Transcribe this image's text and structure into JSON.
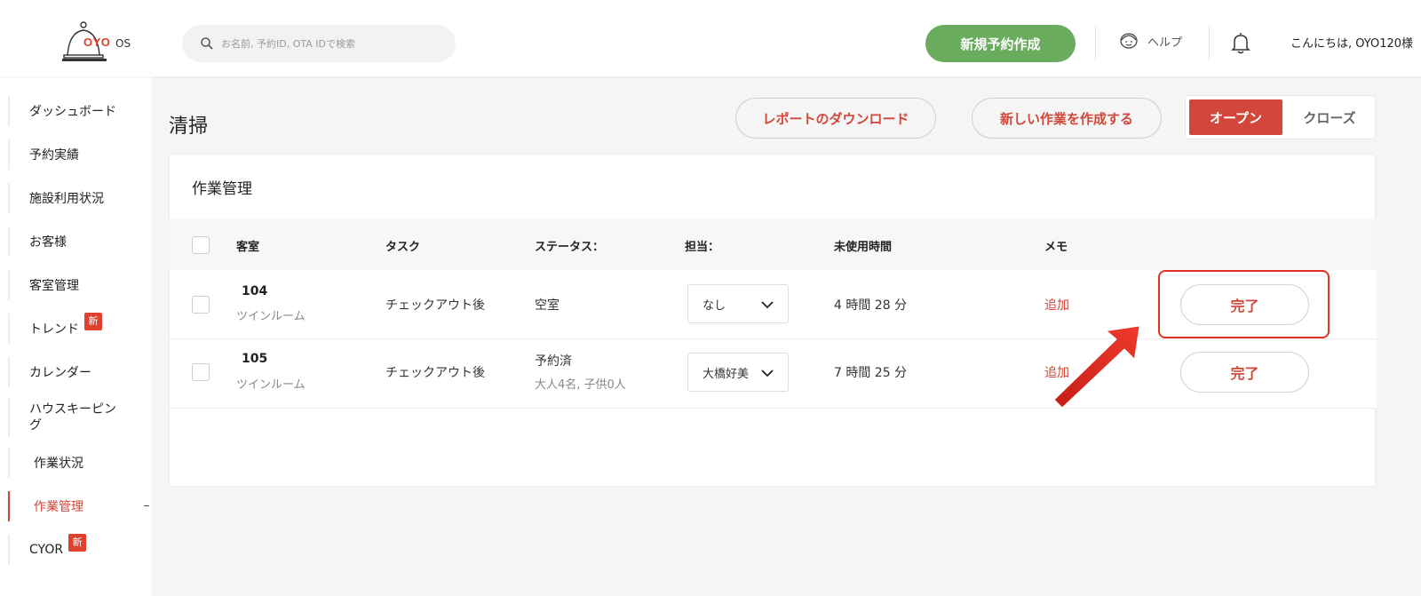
{
  "header": {
    "logo_text": "OYO",
    "logo_suffix": "OS",
    "search_placeholder": "お名前, 予約ID, OTA IDで検索",
    "new_booking": "新規予約作成",
    "help": "ヘルプ",
    "greeting": "こんにちは, OYO120様"
  },
  "sidebar": {
    "items": [
      {
        "label": "ダッシュボード"
      },
      {
        "label": "予約実績"
      },
      {
        "label": "施設利用状況"
      },
      {
        "label": "お客様"
      },
      {
        "label": "客室管理"
      },
      {
        "label": "トレンド",
        "badge": "新"
      },
      {
        "label": "カレンダー"
      },
      {
        "label": "ハウスキーピング"
      },
      {
        "label": "作業状況"
      },
      {
        "label": "作業管理"
      },
      {
        "label": "CYOR",
        "badge": "新"
      }
    ]
  },
  "page": {
    "title": "清掃",
    "download_report": "レポートのダウンロード",
    "create_task": "新しい作業を作成する",
    "toggle_open": "オープン",
    "toggle_close": "クローズ"
  },
  "table": {
    "card_title": "作業管理",
    "headers": [
      "客室",
      "タスク",
      "ステータス：",
      "担当：",
      "未使用時間",
      "メモ"
    ],
    "rows": [
      {
        "room": "104",
        "room_type": "ツインルーム",
        "task": "チェックアウト後",
        "status": "空室",
        "status_detail": "",
        "assignee": "なし",
        "idle": "4 時間 28 分",
        "memo": "追加",
        "action": "完了"
      },
      {
        "room": "105",
        "room_type": "ツインルーム",
        "task": "チェックアウト後",
        "status": "予約済",
        "status_detail": "大人4名, 子供0人",
        "assignee": "大橋好美",
        "idle": "7 時間 25 分",
        "memo": "追加",
        "action": "完了"
      }
    ]
  },
  "colors": {
    "accent": "#d2473a",
    "green": "#6aac5d",
    "annotation": "#e23226"
  },
  "icons": [
    "search-icon",
    "help-headset-icon",
    "bell-icon",
    "chevron-down-icon",
    "annotation-arrow"
  ]
}
